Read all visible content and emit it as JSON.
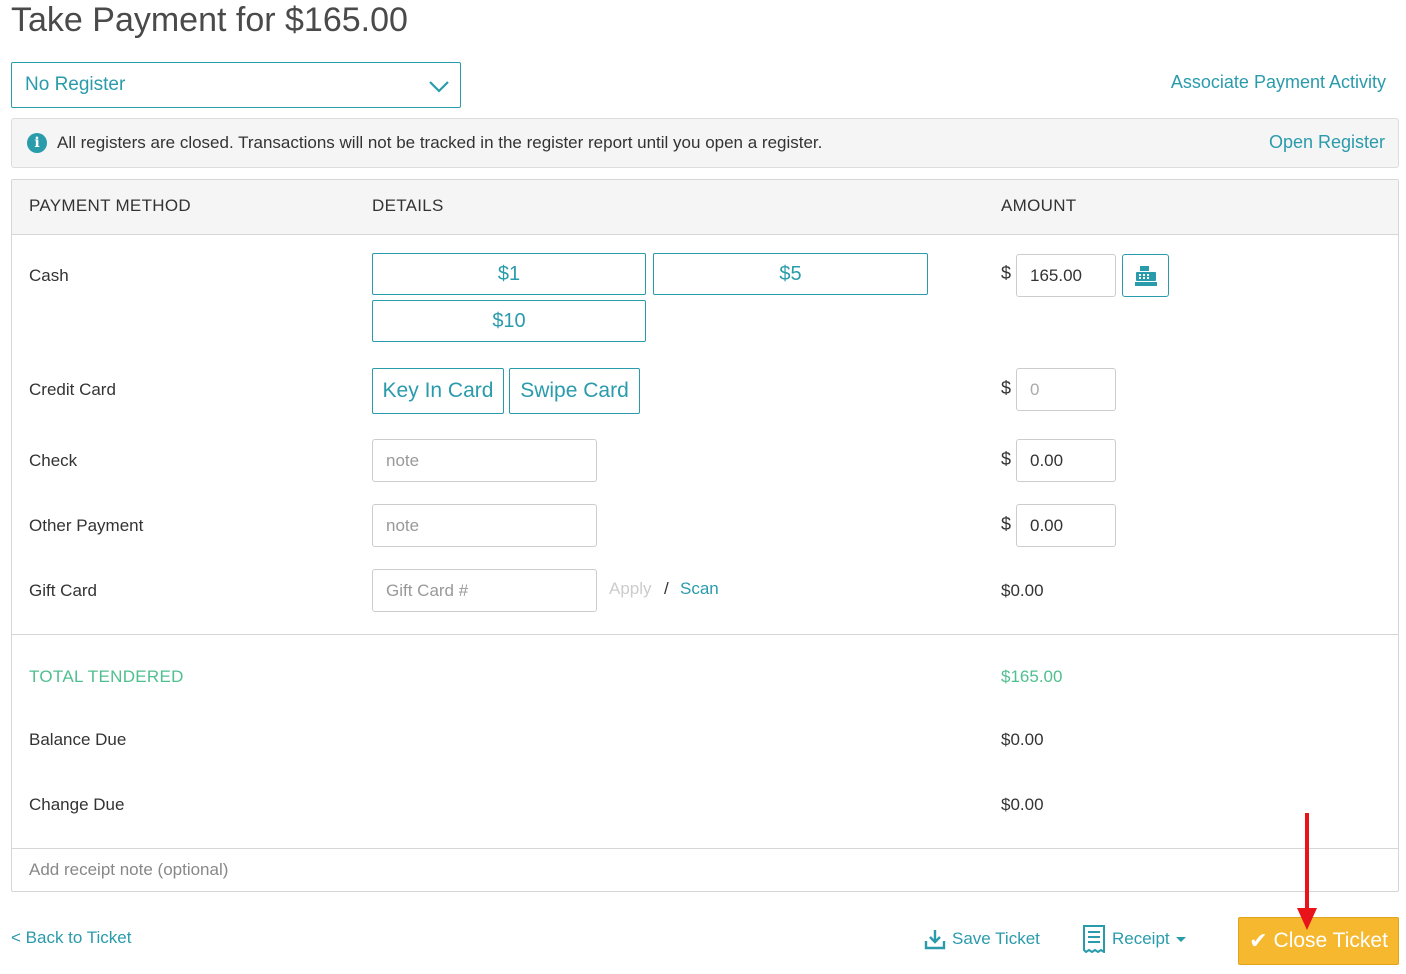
{
  "page": {
    "title": "Take Payment for $165.00"
  },
  "register": {
    "selected": "No Register"
  },
  "links": {
    "associate_payment": "Associate Payment Activity",
    "open_register": "Open Register"
  },
  "alert": {
    "message": "All registers are closed. Transactions will not be tracked in the register report until you open a register."
  },
  "table": {
    "headers": {
      "method": "PAYMENT METHOD",
      "details": "DETAILS",
      "amount": "AMOUNT"
    },
    "cash": {
      "label": "Cash",
      "quick_amounts": [
        "$1",
        "$5",
        "$10"
      ],
      "currency": "$",
      "amount": "165.00"
    },
    "credit_card": {
      "label": "Credit Card",
      "key_in": "Key In Card",
      "swipe": "Swipe Card",
      "currency": "$",
      "amount_placeholder": "0"
    },
    "check": {
      "label": "Check",
      "note_placeholder": "note",
      "currency": "$",
      "amount": "0.00"
    },
    "other": {
      "label": "Other Payment",
      "note_placeholder": "note",
      "currency": "$",
      "amount": "0.00"
    },
    "gift_card": {
      "label": "Gift Card",
      "placeholder": "Gift Card #",
      "apply": "Apply",
      "slash": "/",
      "scan": "Scan",
      "amount": "$0.00"
    }
  },
  "totals": {
    "tendered_label": "TOTAL TENDERED",
    "tendered_value": "$165.00",
    "balance_label": "Balance Due",
    "balance_value": "$0.00",
    "change_label": "Change Due",
    "change_value": "$0.00"
  },
  "receipt_note": {
    "placeholder": "Add receipt note (optional)"
  },
  "footer": {
    "back": "< Back to Ticket",
    "save": "Save Ticket",
    "receipt": "Receipt",
    "close": "Close Ticket"
  },
  "colors": {
    "accent": "#2a9bab",
    "success": "#4fbf8f",
    "close_button": "#f5b82e",
    "annotation": "#e8141a"
  }
}
